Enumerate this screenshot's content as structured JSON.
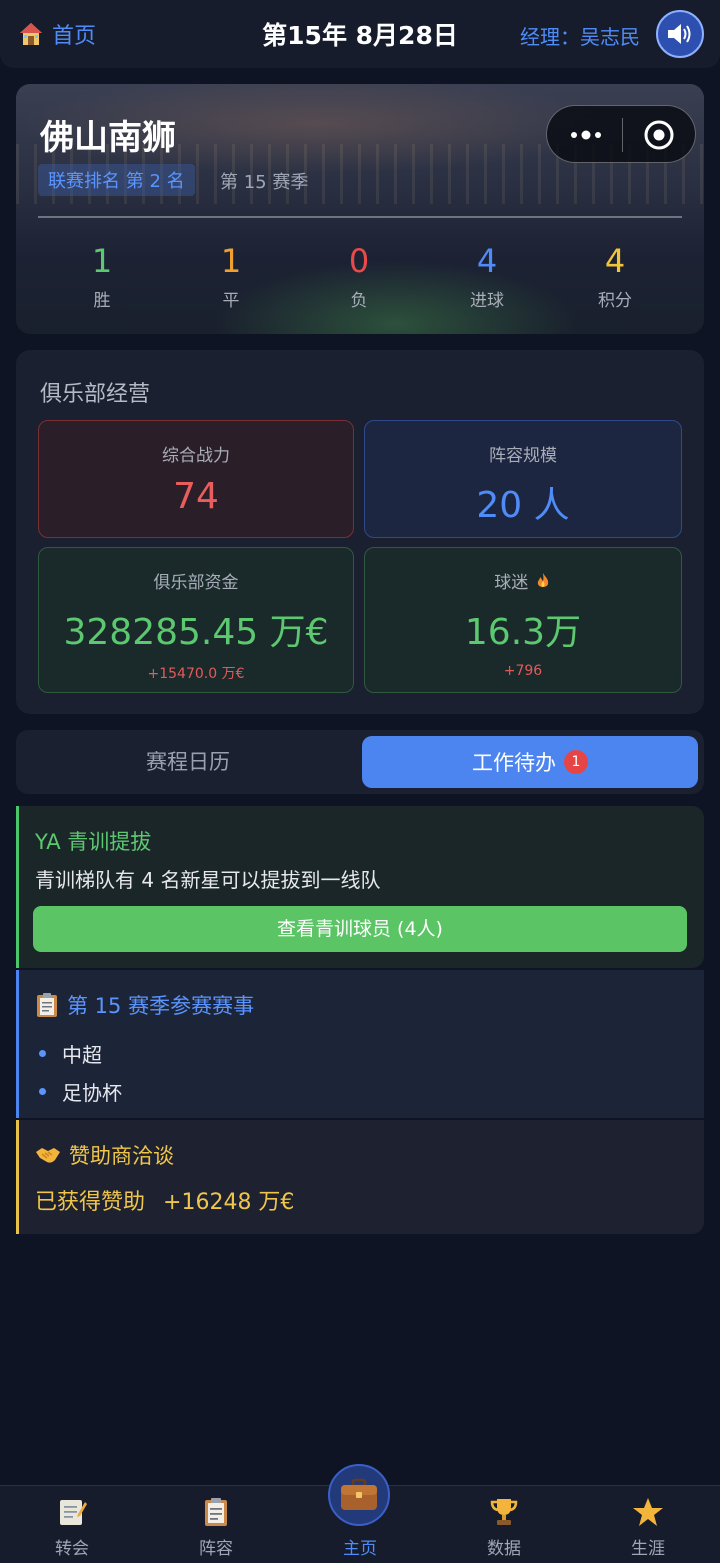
{
  "header": {
    "home_label": "首页",
    "date": "第15年 8月28日",
    "manager": "经理：吴志民",
    "sound_icon": "speaker-icon"
  },
  "team": {
    "name": "佛山南狮",
    "rank": "联赛排名 第 2 名",
    "season": "第 15 赛季",
    "stats": [
      {
        "value": "1",
        "label": "胜",
        "color": "#5cc86f"
      },
      {
        "value": "1",
        "label": "平",
        "color": "#f0a030"
      },
      {
        "value": "0",
        "label": "负",
        "color": "#e64a4a"
      },
      {
        "value": "4",
        "label": "进球",
        "color": "#4f8cf7"
      },
      {
        "value": "4",
        "label": "积分",
        "color": "#f2c43a"
      }
    ]
  },
  "club": {
    "title": "俱乐部经营",
    "power": {
      "label": "综合战力",
      "value": "74",
      "color": "#e85d5d"
    },
    "squad": {
      "label": "阵容规模",
      "value": "20 人",
      "color": "#4f8cf7"
    },
    "funds": {
      "label": "俱乐部资金",
      "value": "328285.45 万€",
      "delta": "+15470.0 万€",
      "color": "#5cc86f"
    },
    "fans": {
      "label": "球迷",
      "value": "16.3万",
      "delta": "+796",
      "color": "#5cc86f",
      "icon": "fire-icon"
    }
  },
  "tabs": {
    "schedule": "赛程日历",
    "todo": "工作待办",
    "todo_badge": "1"
  },
  "todos": {
    "ya": {
      "title": "YA 青训提拔",
      "desc": "青训梯队有 4 名新星可以提拔到一线队",
      "button": "查看青训球员 (4人)"
    },
    "competitions": {
      "title": "第 15 赛季参赛赛事",
      "icon": "clipboard-icon",
      "items": [
        "中超",
        "足协杯"
      ]
    },
    "sponsor": {
      "title": "赞助商洽谈",
      "icon": "handshake-icon",
      "amount_label": "已获得赞助",
      "amount": "+16248 万€"
    }
  },
  "nav": [
    {
      "label": "转会",
      "icon": "memo-icon"
    },
    {
      "label": "阵容",
      "icon": "clipboard-icon"
    },
    {
      "label": "主页",
      "icon": "briefcase-icon",
      "active": true
    },
    {
      "label": "数据",
      "icon": "trophy-icon"
    },
    {
      "label": "生涯",
      "icon": "star-icon"
    }
  ]
}
